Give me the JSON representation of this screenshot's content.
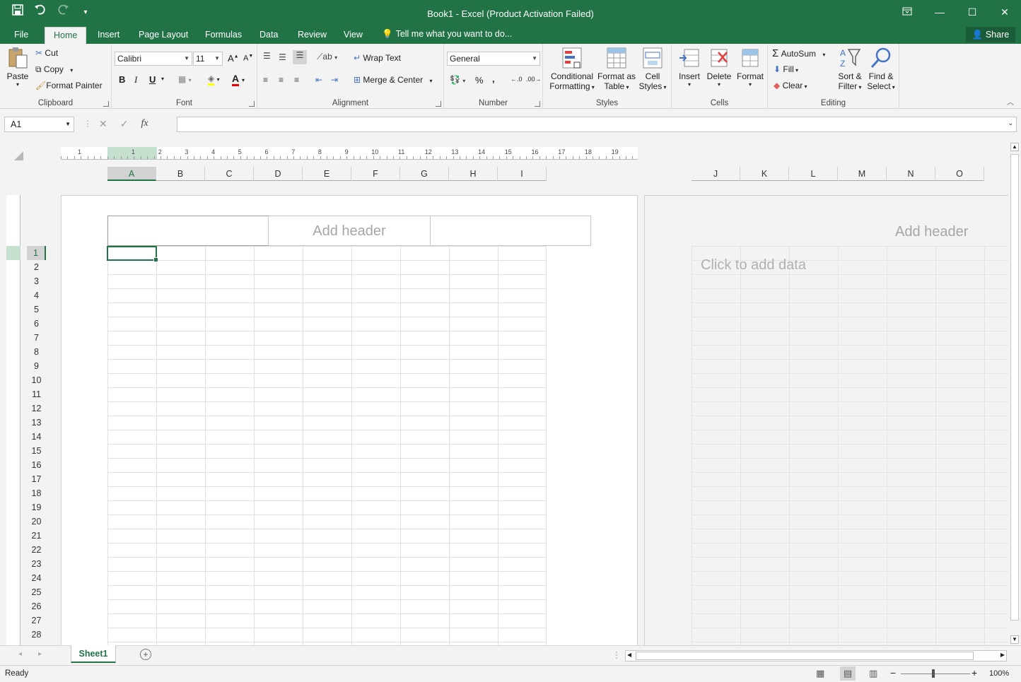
{
  "window": {
    "title": "Book1 - Excel (Product Activation Failed)",
    "colors": {
      "brand": "#217346",
      "selected_header": "#d2d2d2"
    }
  },
  "qat": {
    "save_icon": "save-icon",
    "undo_icon": "undo-icon",
    "redo_icon": "redo-icon",
    "customize_icon": "customize-qat-icon"
  },
  "tabs": [
    {
      "label": "File"
    },
    {
      "label": "Home"
    },
    {
      "label": "Insert"
    },
    {
      "label": "Page Layout"
    },
    {
      "label": "Formulas"
    },
    {
      "label": "Data"
    },
    {
      "label": "Review"
    },
    {
      "label": "View"
    }
  ],
  "tellme": "Tell me what you want to do...",
  "share": "Share",
  "ribbon": {
    "clipboard": {
      "label": "Clipboard",
      "paste": "Paste",
      "cut": "Cut",
      "copy": "Copy",
      "format_painter": "Format Painter"
    },
    "font": {
      "label": "Font",
      "font_name": "Calibri",
      "font_size": "11",
      "bold": "B",
      "italic": "I",
      "underline": "U"
    },
    "alignment": {
      "label": "Alignment",
      "wrap_text": "Wrap Text",
      "merge_center": "Merge & Center"
    },
    "number": {
      "label": "Number",
      "format": "General",
      "percent": "%",
      "comma": ","
    },
    "styles": {
      "label": "Styles",
      "conditional_1": "Conditional",
      "conditional_2": "Formatting",
      "format_table_1": "Format as",
      "format_table_2": "Table",
      "cell_styles_1": "Cell",
      "cell_styles_2": "Styles"
    },
    "cells": {
      "label": "Cells",
      "insert": "Insert",
      "delete": "Delete",
      "format": "Format"
    },
    "editing": {
      "label": "Editing",
      "autosum": "AutoSum",
      "fill": "Fill",
      "clear": "Clear",
      "sort_1": "Sort &",
      "sort_2": "Filter",
      "find_1": "Find &",
      "find_2": "Select"
    }
  },
  "formula_bar": {
    "name_box": "A1",
    "fx": "fx",
    "value": ""
  },
  "ruler_numbers": [
    "1",
    "1",
    "2",
    "3",
    "4",
    "5",
    "6",
    "7",
    "8",
    "9",
    "10",
    "11",
    "12",
    "13",
    "14",
    "15",
    "16",
    "17",
    "18",
    "19"
  ],
  "columns_page1": [
    "A",
    "B",
    "C",
    "D",
    "E",
    "F",
    "G",
    "H",
    "I"
  ],
  "columns_page2": [
    "J",
    "K",
    "L",
    "M",
    "N",
    "O"
  ],
  "rows": [
    "1",
    "2",
    "3",
    "4",
    "5",
    "6",
    "7",
    "8",
    "9",
    "10",
    "11",
    "12",
    "13",
    "14",
    "15",
    "16",
    "17",
    "18",
    "19",
    "20",
    "21",
    "22",
    "23",
    "24",
    "25",
    "26",
    "27",
    "28"
  ],
  "page": {
    "add_header_1": "Add header",
    "add_header_2": "Add header",
    "click_to_add": "Click to add data"
  },
  "sheet_tabs": [
    {
      "label": "Sheet1"
    }
  ],
  "status": {
    "ready": "Ready",
    "zoom": "100%"
  }
}
